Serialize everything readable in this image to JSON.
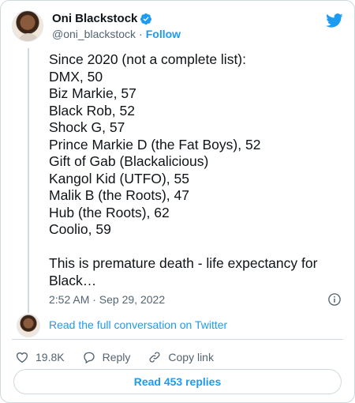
{
  "author": {
    "name": "Oni Blackstock",
    "handle": "@oni_blackstock",
    "separator": "·",
    "follow_label": "Follow"
  },
  "tweet": {
    "text": "Since 2020 (not a complete list):\nDMX, 50\nBiz Markie, 57\nBlack Rob, 52\nShock G, 57\nPrince Markie D (the Fat Boys), 52\nGift of Gab (Blackalicious)\nKangol Kid (UTFO), 55\nMalik B (the Roots), 47\nHub (the Roots), 62\nCoolio, 59\n\nThis is premature death - life expectancy for Black…",
    "timestamp": "2:52 AM · Sep 29, 2022"
  },
  "conversation_link": "Read the full conversation on Twitter",
  "actions": {
    "likes": "19.8K",
    "reply_label": "Reply",
    "copy_link_label": "Copy link"
  },
  "read_replies_label": "Read 453 replies",
  "colors": {
    "accent": "#1d9bf0",
    "text": "#0f1419",
    "muted": "#536471",
    "border": "#cfd9de"
  },
  "icons": [
    "verified-badge-icon",
    "twitter-bird-icon",
    "info-icon",
    "heart-icon",
    "reply-icon",
    "link-icon"
  ]
}
